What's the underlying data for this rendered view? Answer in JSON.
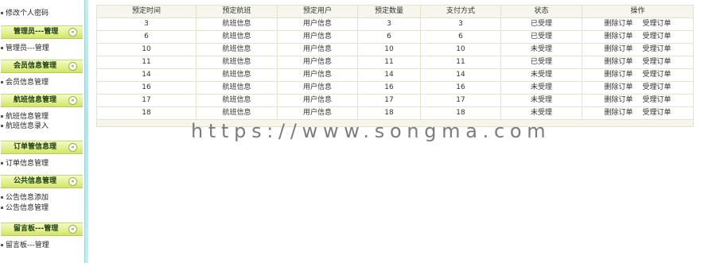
{
  "sidebar": {
    "top_item": "修改个人密码",
    "sections": [
      {
        "title": "管理员---管理",
        "items": [
          "管理员---管理"
        ]
      },
      {
        "title": "会员信息管理",
        "items": [
          "会员信息管理"
        ]
      },
      {
        "title": "航班信息管理",
        "items": [
          "航班信息管理",
          "航班信息录入"
        ]
      },
      {
        "title": "订单管信息理",
        "items": [
          "订单信息管理"
        ]
      },
      {
        "title": "公共信息管理",
        "items": [
          "公告信息添加",
          "公告信息管理"
        ]
      },
      {
        "title": "留言板---管理",
        "items": [
          "留言板---管理"
        ]
      }
    ]
  },
  "table": {
    "headers": [
      "预定时间",
      "预定航班",
      "预定用户",
      "预定数量",
      "支付方式",
      "状态",
      "操作"
    ],
    "rows": [
      {
        "time": "3",
        "flight": "航班信息",
        "user": "用户信息",
        "qty": "3",
        "pay": "3",
        "status": "已受理",
        "delete": "删除订单",
        "accept": "受理订单"
      },
      {
        "time": "6",
        "flight": "航班信息",
        "user": "用户信息",
        "qty": "6",
        "pay": "6",
        "status": "已受理",
        "delete": "删除订单",
        "accept": "受理订单"
      },
      {
        "time": "10",
        "flight": "航班信息",
        "user": "用户信息",
        "qty": "10",
        "pay": "10",
        "status": "未受理",
        "delete": "删除订单",
        "accept": "受理订单"
      },
      {
        "time": "11",
        "flight": "航班信息",
        "user": "用户信息",
        "qty": "11",
        "pay": "11",
        "status": "已受理",
        "delete": "删除订单",
        "accept": "受理订单"
      },
      {
        "time": "14",
        "flight": "航班信息",
        "user": "用户信息",
        "qty": "14",
        "pay": "14",
        "status": "未受理",
        "delete": "删除订单",
        "accept": "受理订单"
      },
      {
        "time": "16",
        "flight": "航班信息",
        "user": "用户信息",
        "qty": "16",
        "pay": "16",
        "status": "未受理",
        "delete": "删除订单",
        "accept": "受理订单"
      },
      {
        "time": "17",
        "flight": "航班信息",
        "user": "用户信息",
        "qty": "17",
        "pay": "17",
        "status": "未受理",
        "delete": "删除订单",
        "accept": "受理订单"
      },
      {
        "time": "18",
        "flight": "航班信息",
        "user": "用户信息",
        "qty": "18",
        "pay": "18",
        "status": "未受理",
        "delete": "删除订单",
        "accept": "受理订单"
      }
    ]
  },
  "watermark": "https://www.songma.com",
  "colors": {
    "status_text": "#d81b1b",
    "section_header": "#e3f08f",
    "sidebar_bg": "#b6e3ea",
    "table_border": "#e4e2c8",
    "header_bg": "#f6f6ee"
  },
  "icons": {
    "section_toggle": "chevron-icon",
    "item_bullet": "bullet-icon"
  }
}
